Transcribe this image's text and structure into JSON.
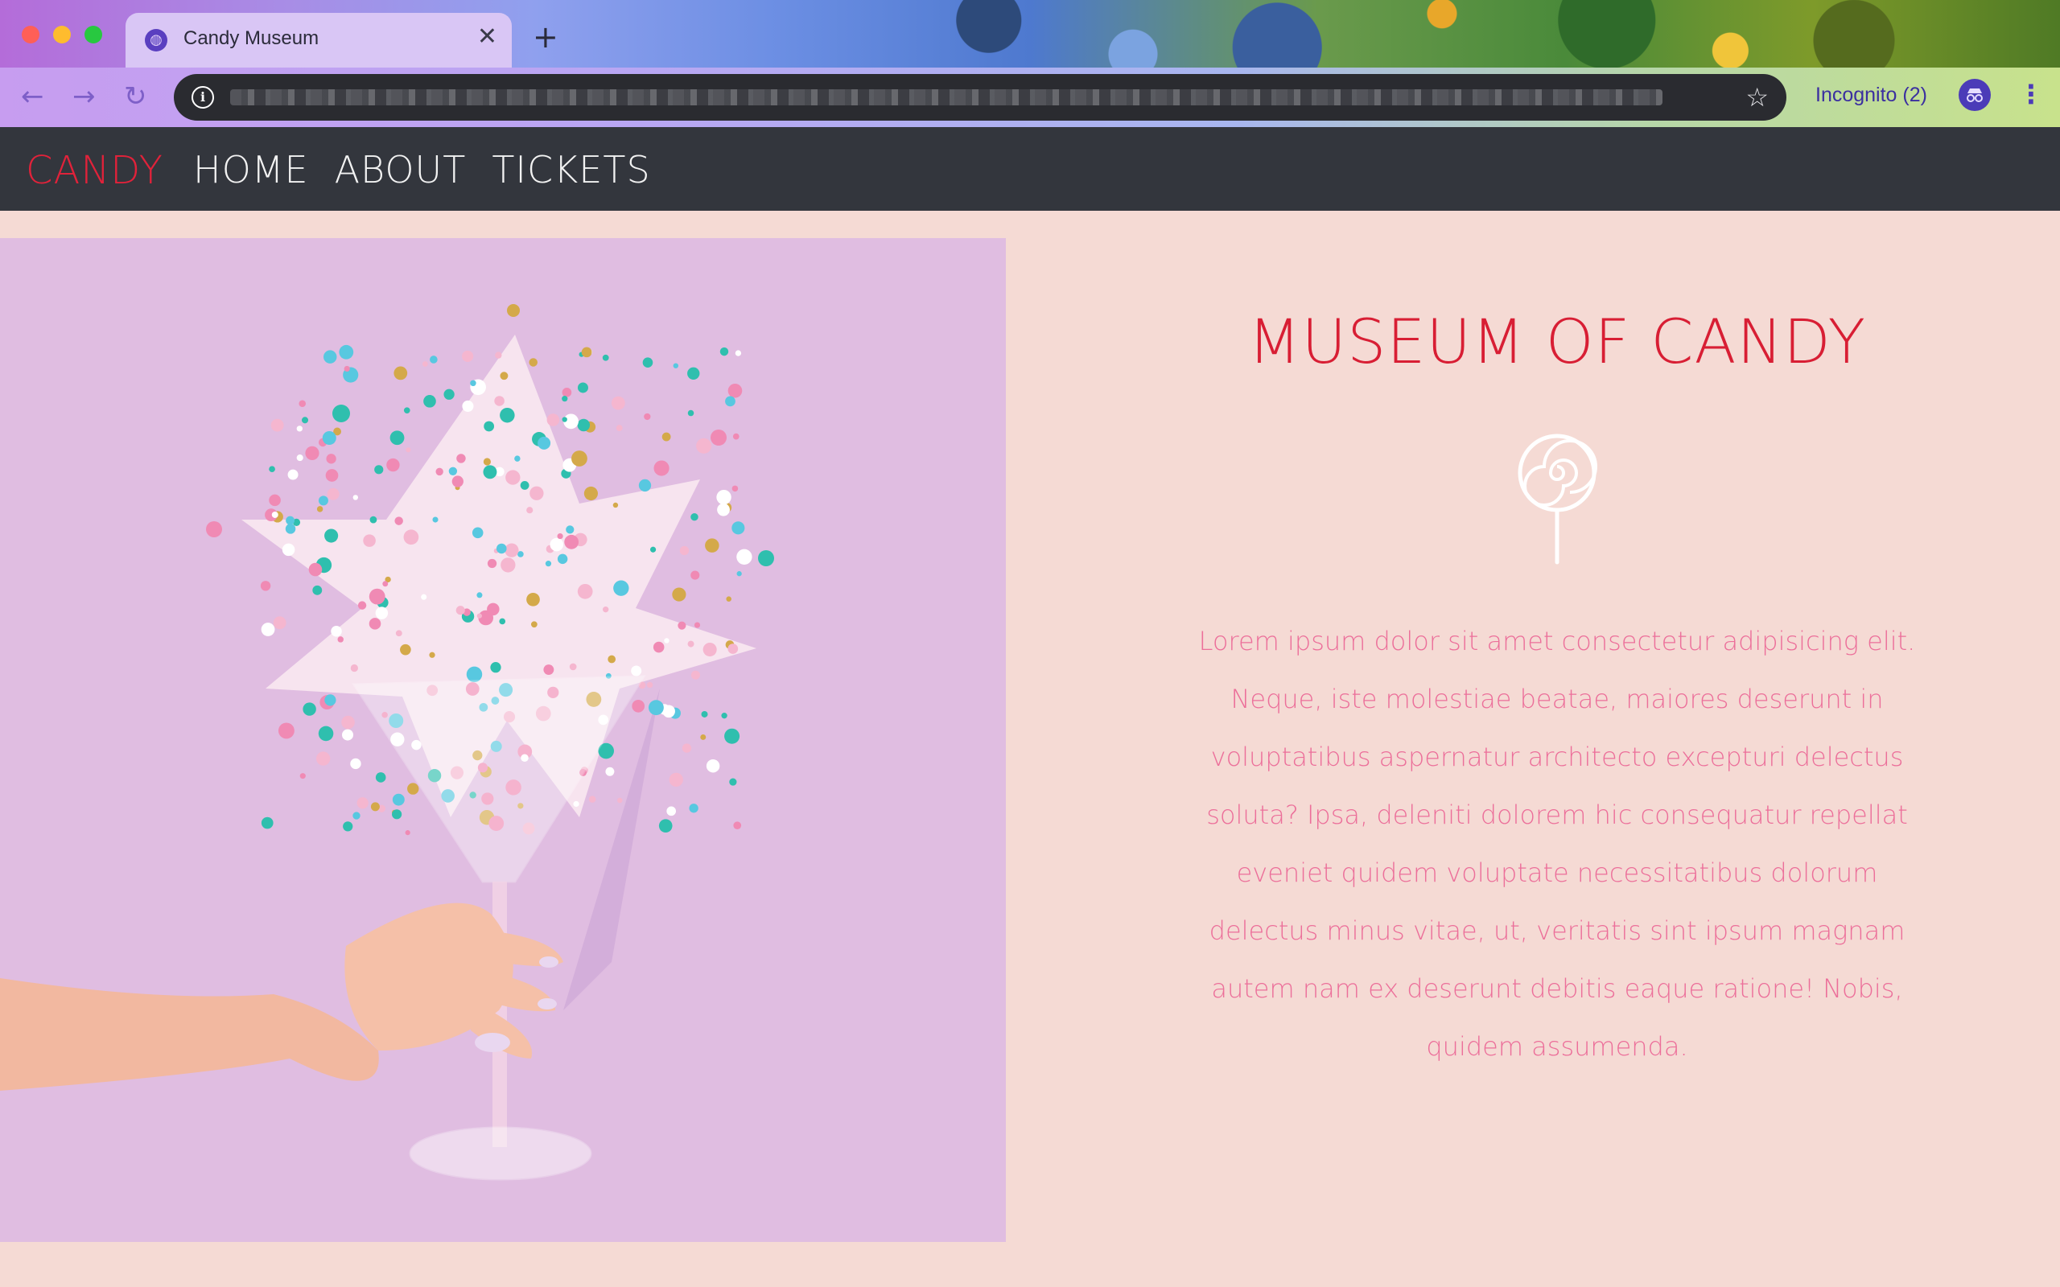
{
  "browser": {
    "tab_title": "Candy Museum",
    "tab_close": "✕",
    "new_tab": "+",
    "incognito_label": "Incognito (2)",
    "nav_icons": [
      "back-arrow-icon",
      "forward-arrow-icon",
      "reload-icon"
    ]
  },
  "navbar": {
    "brand": "CANDY",
    "links": [
      "HOME",
      "ABOUT",
      "TICKETS"
    ],
    "colors": {
      "brand": "#e0223a",
      "background": "#33363d",
      "link": "#f2f2f2"
    }
  },
  "hero": {
    "title": "MUSEUM OF CANDY",
    "icon": "lollipop-icon",
    "body": "Lorem ipsum dolor sit amet consectetur adipisicing elit. Neque, iste molestiae beatae, maiores deserunt in voluptatibus aspernatur architecto excepturi delectus soluta? Ipsa, deleniti dolorem hic consequatur repellat eveniet quidem voluptate necessitatibus dolorum delectus minus vitae, ut, veritatis sint ipsum magnam autem nam ex deserunt debitis eaque ratione! Nobis, quidem assumenda.",
    "colors": {
      "title": "#d81e34",
      "body": "#ec6f9a",
      "page_bg": "#f5dad4",
      "image_bg": "#e0bde1"
    }
  }
}
